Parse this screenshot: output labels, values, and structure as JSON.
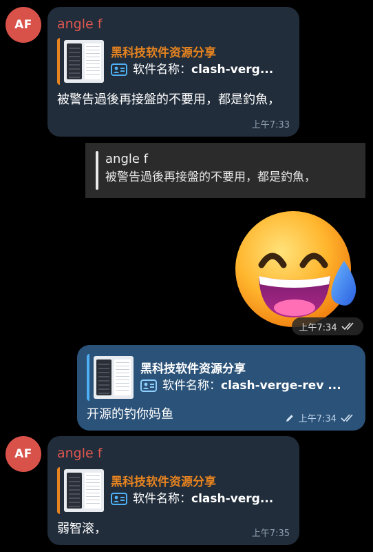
{
  "messages": [
    {
      "avatar": "AF",
      "sender": "angle f",
      "preview_title": "黑科技软件资源分享",
      "preview_label": "软件名称：",
      "preview_name": "clash-verg...",
      "text": "被警告過後再接盤的不要用，都是釣魚，",
      "time": "上午7:33"
    },
    {
      "avatar": "AF",
      "sender": "angle f",
      "preview_title": "黑科技软件资源分享",
      "preview_label": "软件名称：",
      "preview_name": "clash-verg...",
      "text": "弱智滚，",
      "time": "上午7:35"
    }
  ],
  "reply_quote": {
    "name": "angle f",
    "text": "被警告過後再接盤的不要用，都是釣魚，"
  },
  "sticker": {
    "emoji_icon": "grinning-face-with-tear-sticker",
    "time": "上午7:34"
  },
  "outgoing": {
    "preview_title": "黑科技软件资源分享",
    "preview_label": "软件名称：",
    "preview_name": "clash-verge-rev ...",
    "text": "开源的钓你妈鱼",
    "time": "上午7:34"
  },
  "colors": {
    "background": "#000000",
    "incoming_bubble": "#212d3b",
    "outgoing_bubble": "#2b5278",
    "sender_name": "#e0574f",
    "preview_accent": "#e8841f",
    "outgoing_accent": "#4fb0f5",
    "avatar": "#d9524a"
  }
}
